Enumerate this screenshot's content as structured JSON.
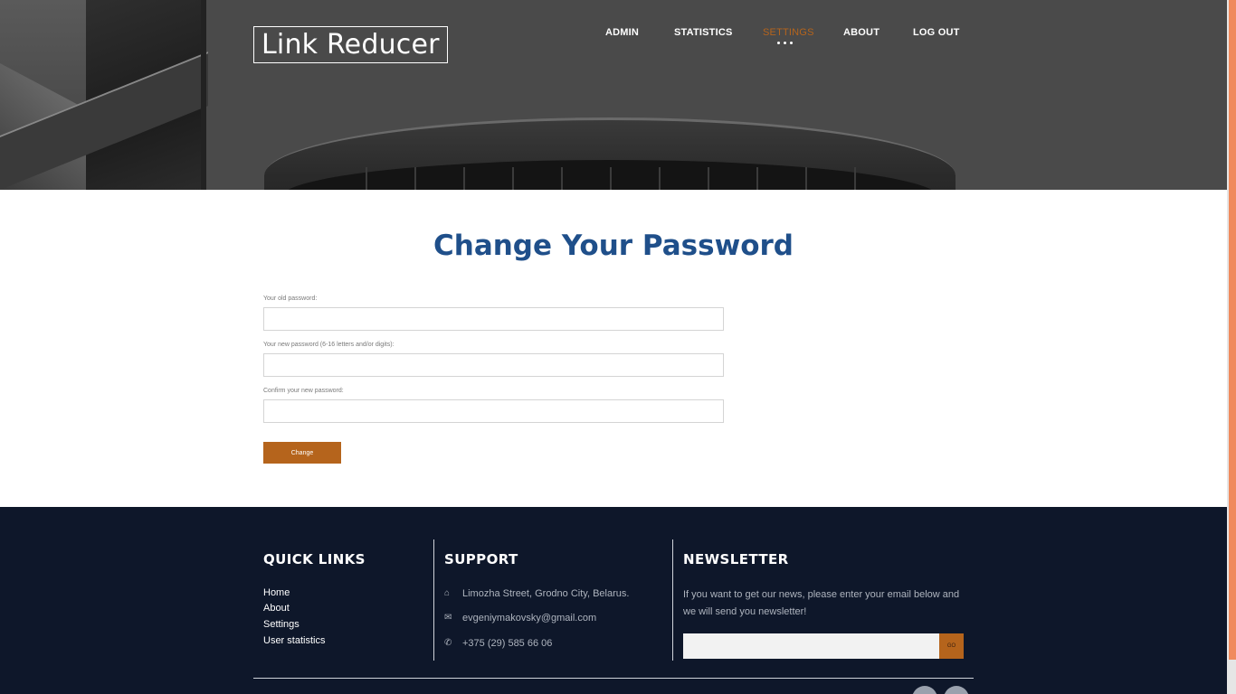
{
  "header": {
    "logo": "Link Reducer",
    "nav": [
      {
        "label": "ADMIN"
      },
      {
        "label": "STATISTICS"
      },
      {
        "label": "SETTINGS"
      },
      {
        "label": "ABOUT"
      },
      {
        "label": "LOG OUT"
      }
    ],
    "active_nav": "SETTINGS"
  },
  "main": {
    "title": "Change Your Password",
    "fields": [
      {
        "label": "Your old password:",
        "value": ""
      },
      {
        "label": "Your new password (6-16 letters and/or digits):",
        "value": ""
      },
      {
        "label": "Confirm your new password:",
        "value": ""
      }
    ],
    "submit_label": "Change"
  },
  "footer": {
    "quick_links": {
      "heading": "QUICK LINKS",
      "items": [
        "Home",
        "About",
        "Settings",
        "User statistics"
      ]
    },
    "support": {
      "heading": "SUPPORT",
      "items": [
        {
          "icon": "home-icon",
          "text": "Limozha Street, Grodno City, Belarus."
        },
        {
          "icon": "mail-icon",
          "text": "evgeniymakovsky@gmail.com"
        },
        {
          "icon": "phone-icon",
          "text": "+375 (29) 585 66 06"
        }
      ]
    },
    "newsletter": {
      "heading": "NEWSLETTER",
      "text": "If you want to get our news, please enter your email below and we will send you newsletter!",
      "input_value": "",
      "button_label": "GO"
    }
  },
  "colors": {
    "accent": "#b5641c",
    "title": "#1f4f8a",
    "footer_bg": "#0e172a"
  }
}
